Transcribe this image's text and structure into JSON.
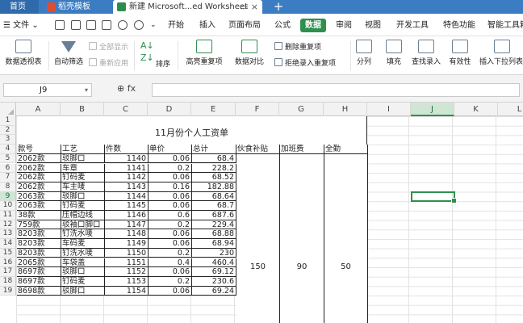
{
  "tabs": {
    "home": "首页",
    "template": "稻壳模板",
    "doc": "新建 Microsoft...ed Worksheet",
    "doc_close": "▭ ×",
    "new_tab": "+"
  },
  "menu": {
    "file": "☰ 文件 ⌄",
    "tabs": [
      "开始",
      "插入",
      "页面布局",
      "公式",
      "数据",
      "审阅",
      "视图",
      "开发工具",
      "特色功能",
      "智能工具箱"
    ],
    "active_index": 4
  },
  "ribbon": {
    "pivot": "数据透视表",
    "autofilter": "自动筛选",
    "show_all": "全部显示",
    "reapply": "重新应用",
    "sort": "排序",
    "highlight_dup": "高亮重复项",
    "compare": "数据对比",
    "remove_dup": "删除重复项",
    "reject_dup": "拒绝录入重复项",
    "split": "分列",
    "fill": "填充",
    "lookup": "查找录入",
    "validity": "有效性",
    "dropdown": "插入下拉列表"
  },
  "formula_bar": {
    "cell_ref": "J9",
    "fx": "⊕ fx"
  },
  "columns": [
    "A",
    "B",
    "C",
    "D",
    "E",
    "F",
    "G",
    "H",
    "I",
    "J",
    "K",
    "L"
  ],
  "selected_column": "J",
  "rows": [
    "1",
    "2",
    "3",
    "4",
    "5",
    "6",
    "7",
    "8",
    "9",
    "10",
    "11",
    "12",
    "13",
    "14",
    "15",
    "16",
    "17",
    "18",
    "19"
  ],
  "selected_row": "9",
  "sheet": {
    "title": "11月份个人工资单",
    "headers": [
      "款号",
      "工艺",
      "件数",
      "单价",
      "总计",
      "伙食补贴",
      "加班费",
      "全勤"
    ],
    "data": [
      [
        "2062款",
        "驳脚口",
        "1140",
        "0.06",
        "68.4"
      ],
      [
        "2062款",
        "车章",
        "1141",
        "0.2",
        "228.2"
      ],
      [
        "2062款",
        "钉码麦",
        "1142",
        "0.06",
        "68.52"
      ],
      [
        "2062款",
        "车主唛",
        "1143",
        "0.16",
        "182.88"
      ],
      [
        "2063款",
        "驳脚口",
        "1144",
        "0.06",
        "68.64"
      ],
      [
        "2063款",
        "钉码麦",
        "1145",
        "0.06",
        "68.7"
      ],
      [
        "38款",
        "压帽边线",
        "1146",
        "0.6",
        "687.6"
      ],
      [
        "759款",
        "驳袖口脚口",
        "1147",
        "0.2",
        "229.4"
      ],
      [
        "8203款",
        "钉洗水唛",
        "1148",
        "0.06",
        "68.88"
      ],
      [
        "8203款",
        "车码麦",
        "1149",
        "0.06",
        "68.94"
      ],
      [
        "8203款",
        "钉洗水唛",
        "1150",
        "0.2",
        "230"
      ],
      [
        "2065款",
        "车袋盖",
        "1151",
        "0.4",
        "460.4"
      ],
      [
        "8697款",
        "驳脚口",
        "1152",
        "0.06",
        "69.12"
      ],
      [
        "8697款",
        "钉码麦",
        "1153",
        "0.2",
        "230.6"
      ],
      [
        "8698款",
        "驳脚口",
        "1154",
        "0.06",
        "69.24"
      ]
    ],
    "meal_allowance": "150",
    "overtime": "90",
    "attendance": "50"
  }
}
